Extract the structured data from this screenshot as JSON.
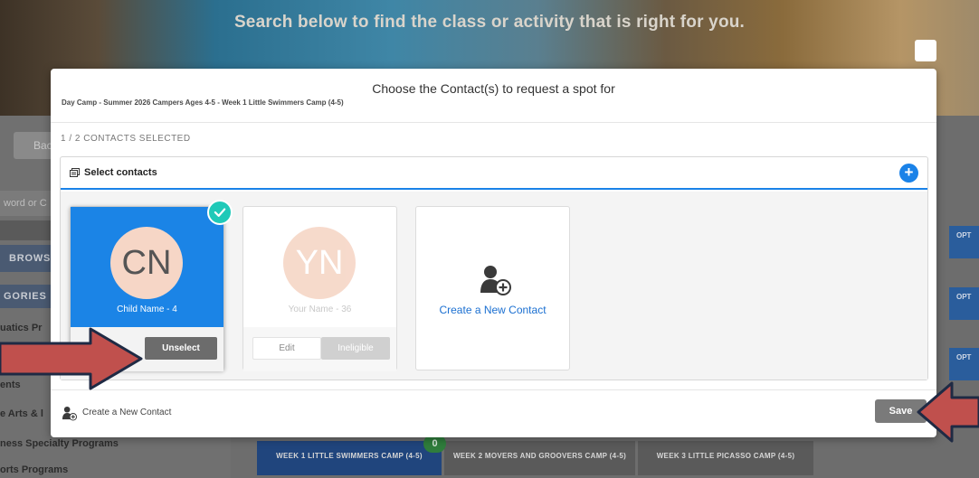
{
  "background": {
    "hero_text": "Search below to find the class or activity that is right for you.",
    "back_label": "Back",
    "keyword_placeholder": "word or C",
    "browse_label": "BROWS",
    "categories_label": "GORIES",
    "category_items": [
      "uatics Pr",
      "ents",
      "e Arts & l",
      "ness Specialty Programs",
      "orts Programs"
    ],
    "option_label": "OPT",
    "week_tabs": [
      "WEEK 1 LITTLE SWIMMERS CAMP (4-5)",
      "WEEK 2 MOVERS AND GROOVERS CAMP (4-5)",
      "WEEK 3 LITTLE PICASSO CAMP (4-5)"
    ],
    "week_badge": "0"
  },
  "modal": {
    "title": "Choose the Contact(s) to request a spot for",
    "subtitle": "Day Camp - Summer 2026 Campers Ages 4-5 - Week 1 Little Swimmers Camp (4-5)",
    "selected_count": "1 / 2 CONTACTS SELECTED",
    "panel_label": "Select contacts",
    "add_symbol": "+",
    "contacts": [
      {
        "initials": "CN",
        "name": "Child Name - 4",
        "selected": true,
        "action_label": "Unselect"
      },
      {
        "initials": "YN",
        "name": "Your Name - 36",
        "selected": false,
        "edit_label": "Edit",
        "status_label": "Ineligible"
      }
    ],
    "create_card_label": "Create a New Contact",
    "footer_create_label": "Create a New Contact",
    "save_label": "Save"
  },
  "colors": {
    "accent_blue": "#1b84e6",
    "check_teal": "#1fc9b8",
    "annotation_arrow": "#c0504d",
    "annotation_outline": "#1f2a44"
  },
  "icons": [
    "checkmark-icon",
    "plus-icon",
    "contacts-list-icon",
    "add-contact-icon",
    "arrow-annotation"
  ]
}
